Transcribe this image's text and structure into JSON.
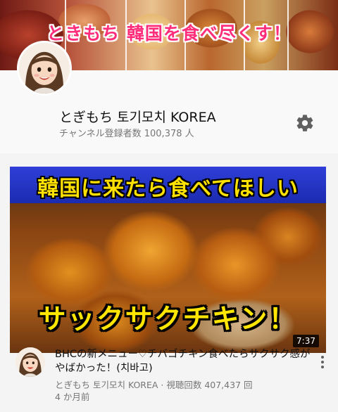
{
  "banner": {
    "title": "ときもち 韓国を食べ尽くす！"
  },
  "channel": {
    "name": "とぎもち 토기모치 KOREA",
    "subscribers": "チャンネル登録者数 100,378 人",
    "settings_icon": "gear-icon"
  },
  "video": {
    "thumbnail_top_text": "韓国に来たら食べてほしい",
    "thumbnail_bottom_text": "サックサクチキン！",
    "duration": "7:37",
    "title": "BHCの新メニュー♡チバゴチキン食べたらサクサク感がやばかった！(치바고)",
    "channel_and_views": "とぎもち 토기모치 KOREA · 視聴回数 407,437 回",
    "age": "4 か月前",
    "menu_icon": "more-vertical-icon"
  },
  "colors": {
    "banner_title": "#ff2d7a",
    "thumb_band": "#1b2bb0",
    "thumb_text": "#ffe600",
    "secondary_text": "#767676"
  }
}
